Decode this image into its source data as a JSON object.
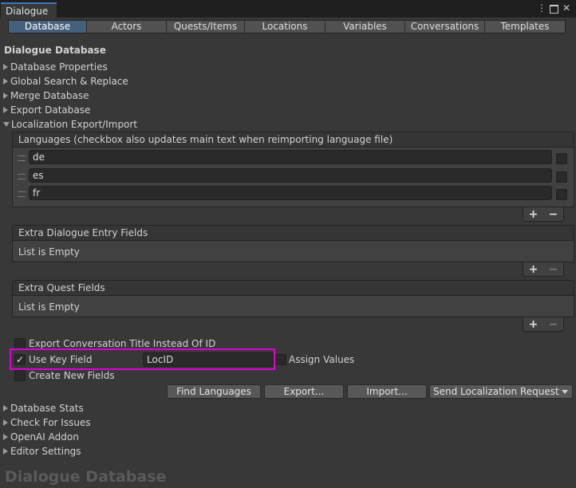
{
  "window": {
    "tab_title": "Dialogue"
  },
  "tabs": [
    "Database",
    "Actors",
    "Quests/Items",
    "Locations",
    "Variables",
    "Conversations",
    "Templates"
  ],
  "header_title": "Dialogue Database",
  "foldouts_top": [
    "Database Properties",
    "Global Search & Replace",
    "Merge Database",
    "Export Database"
  ],
  "localization": {
    "title": "Localization Export/Import",
    "languages_header": "Languages (checkbox also updates main text when reimporting language file)",
    "languages": [
      "de",
      "es",
      "fr"
    ],
    "extra_entry_header": "Extra Dialogue Entry Fields",
    "extra_entry_empty": "List is Empty",
    "extra_quest_header": "Extra Quest Fields",
    "extra_quest_empty": "List is Empty",
    "plus": "+",
    "minus": "−",
    "export_title_label": "Export Conversation Title Instead Of ID",
    "use_key_label": "Use Key Field",
    "key_field_value": "LocID",
    "assign_values_label": "Assign Values",
    "create_fields_label": "Create New Fields",
    "buttons": {
      "find_languages": "Find Languages",
      "export": "Export...",
      "import": "Import...",
      "send_request": "Send Localization Request"
    }
  },
  "foldouts_bottom": [
    "Database Stats",
    "Check For Issues",
    "OpenAI Addon",
    "Editor Settings"
  ],
  "footer_title": "Dialogue Database",
  "colors": {
    "active_tab": "#46607c",
    "highlight": "#e000d8"
  }
}
